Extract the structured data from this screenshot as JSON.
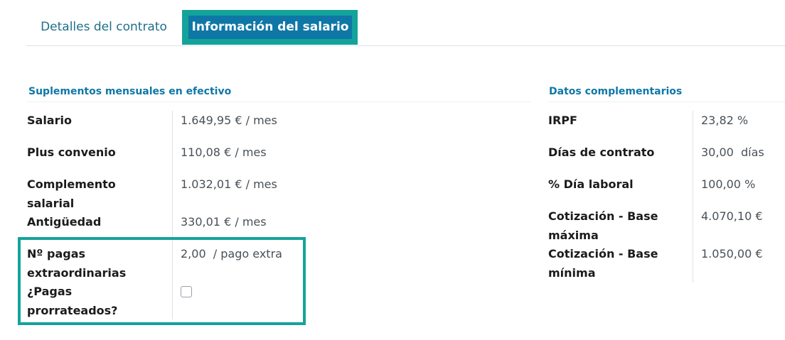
{
  "tabs": [
    {
      "label": "Detalles del contrato",
      "active": false
    },
    {
      "label": "Información del salario",
      "active": true
    }
  ],
  "left_section": {
    "title": "Suplementos mensuales en efectivo",
    "rows": [
      {
        "label": "Salario",
        "value": "1.649,95 €",
        "unit": "/ mes"
      },
      {
        "label": "Plus convenio",
        "value": "110,08 €",
        "unit": "/ mes"
      },
      {
        "label_lines": [
          "Complemento",
          "salarial"
        ],
        "value": "1.032,01 €",
        "unit": "/ mes"
      },
      {
        "label": "Antigüedad",
        "value": "330,01 €",
        "unit": "/ mes"
      },
      {
        "label_lines": [
          "Nº pagas",
          "extraordinarias"
        ],
        "value": "2,00",
        "unit": "/ pago extra"
      },
      {
        "label_lines": [
          "¿Pagas",
          "prorrateados?"
        ],
        "checked": false
      }
    ]
  },
  "right_section": {
    "title": "Datos complementarios",
    "rows": [
      {
        "label": "IRPF",
        "value": "23,82",
        "unit": "%"
      },
      {
        "label": "Días de contrato",
        "value": "30,00",
        "unit": "días"
      },
      {
        "label": "% Día laboral",
        "value": "100,00",
        "unit": "%"
      },
      {
        "label_lines": [
          "Cotización - Base",
          "máxima"
        ],
        "value": "4.070,10 €"
      },
      {
        "label_lines": [
          "Cotización - Base",
          "mínima"
        ],
        "value": "1.050,00 €"
      }
    ]
  },
  "colors": {
    "accent": "#0f77a6",
    "highlight": "#14a39a"
  }
}
